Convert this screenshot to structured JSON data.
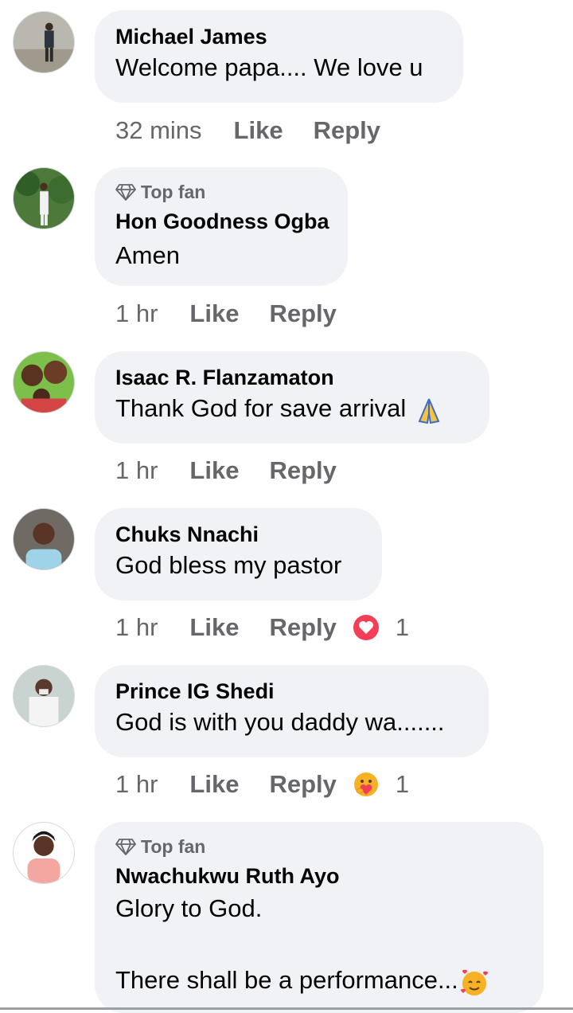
{
  "comments": [
    {
      "name": "Michael James",
      "top_fan": false,
      "text": "Welcome papa.... We love u",
      "time": "32 mins",
      "like": "Like",
      "reply": "Reply"
    },
    {
      "name": "Hon Goodness Ogba",
      "top_fan": true,
      "badge": "Top fan",
      "text": "Amen",
      "time": "1 hr",
      "like": "Like",
      "reply": "Reply"
    },
    {
      "name": "Isaac R. Flanzamaton",
      "top_fan": false,
      "text": "Thank God for save arrival",
      "emoji": "folded-hands-emoji",
      "time": "1 hr",
      "like": "Like",
      "reply": "Reply"
    },
    {
      "name": "Chuks Nnachi",
      "top_fan": false,
      "text": "God bless my pastor",
      "time": "1 hr",
      "like": "Like",
      "reply": "Reply",
      "reaction": {
        "icon": "love-reaction-icon",
        "count": "1",
        "color": "#f33e58"
      }
    },
    {
      "name": "Prince IG Shedi",
      "top_fan": false,
      "text": "God is with you daddy wa.......",
      "time": "1 hr",
      "like": "Like",
      "reply": "Reply",
      "reaction": {
        "icon": "care-reaction-icon",
        "count": "1",
        "color": "#f7b125"
      }
    },
    {
      "name": "Nwachukwu Ruth Ayo",
      "top_fan": true,
      "badge": "Top fan",
      "text": "Glory to God.\n\nThere shall be a performance...",
      "emoji": "smiling-face-with-hearts-emoji"
    }
  ],
  "colors": {
    "bubble": "#f0f2f5",
    "meta": "#65676b",
    "text": "#050505"
  }
}
